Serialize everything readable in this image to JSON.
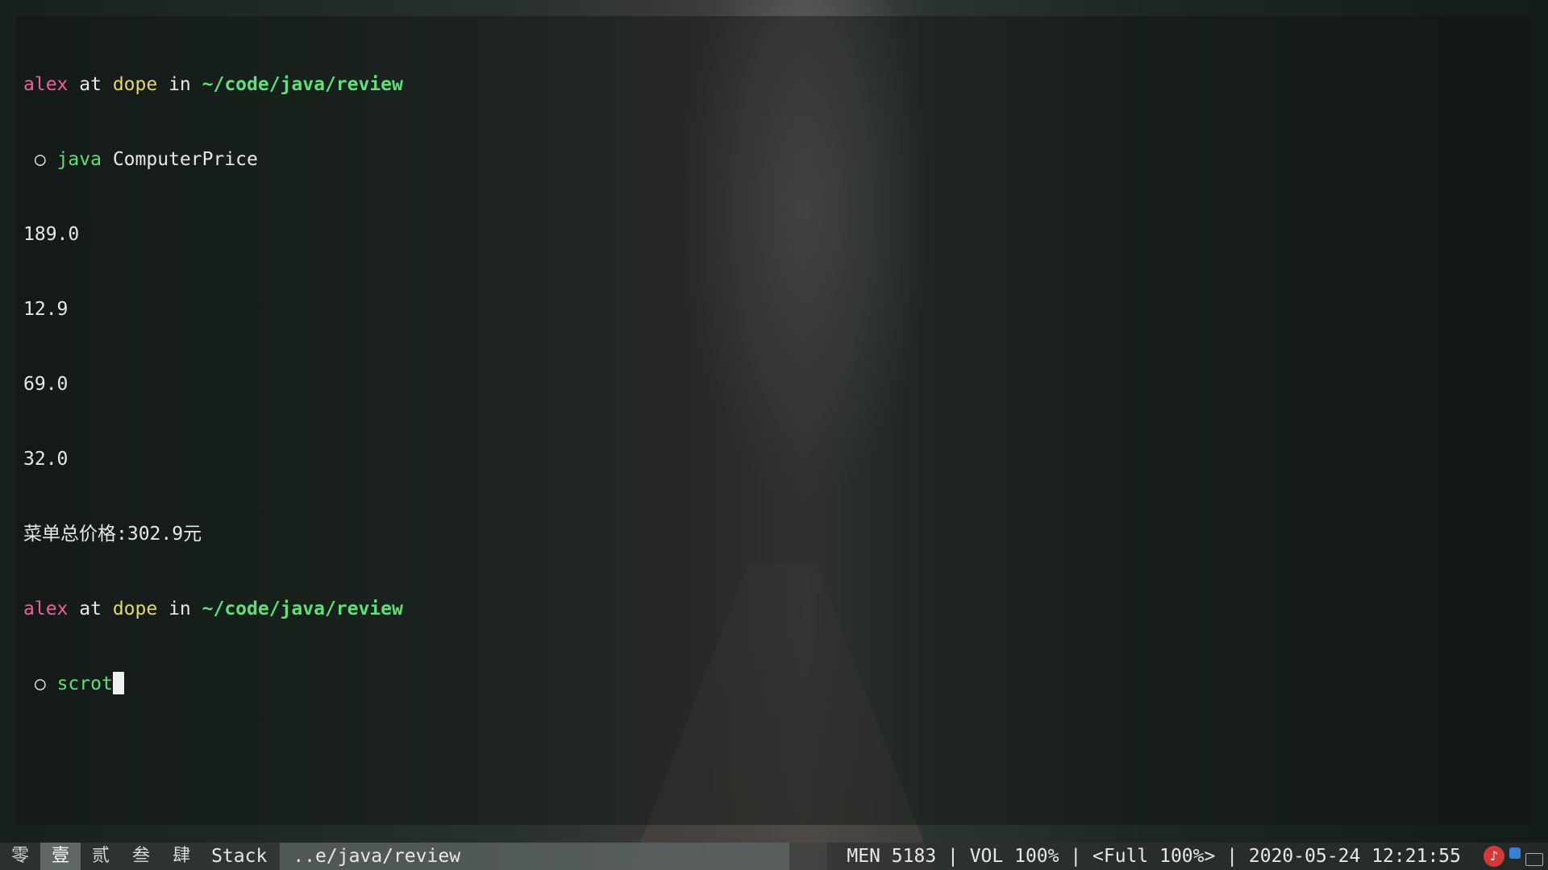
{
  "terminal": {
    "prompt1": {
      "user": "alex",
      "at": "at",
      "host": "dope",
      "in": "in",
      "path": "~/code/java/review"
    },
    "command1": {
      "bullet": "○",
      "program": "java",
      "args": "ComputerPrice"
    },
    "output": [
      "189.0",
      "12.9",
      "69.0",
      "32.0",
      "菜单总价格:302.9元"
    ],
    "prompt2": {
      "user": "alex",
      "at": "at",
      "host": "dope",
      "in": "in",
      "path": "~/code/java/review"
    },
    "command2": {
      "bullet": "○",
      "program": "scrot"
    }
  },
  "statusbar": {
    "workspaces": [
      {
        "label": "零",
        "active": false
      },
      {
        "label": "壹",
        "active": true
      },
      {
        "label": "贰",
        "active": false
      },
      {
        "label": "叁",
        "active": false
      },
      {
        "label": "肆",
        "active": false
      }
    ],
    "layout": "Stack",
    "window_title": "..e/java/review",
    "system": "MEN 5183 | VOL 100% | <Full 100%> | 2020-05-24 12:21:55",
    "tray_icons": [
      "netease-music-icon",
      "bluetooth-icon",
      "keyboard-icon"
    ]
  },
  "colors": {
    "user": "#ef5fa0",
    "host": "#e6d66a",
    "path": "#5fe07a",
    "text": "#e8e8e8"
  }
}
